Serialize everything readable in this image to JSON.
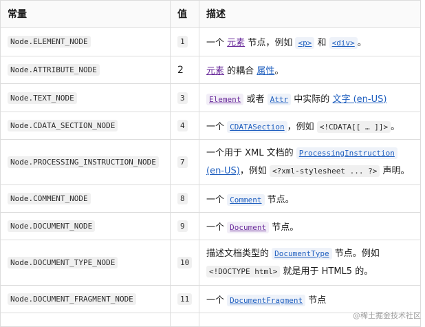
{
  "headers": [
    "常量",
    "值",
    "描述"
  ],
  "rows": [
    {
      "constant": "Node.ELEMENT_NODE",
      "value": "1",
      "desc": {
        "t1": "一个",
        "l1": "元素",
        "t2": "节点，例如",
        "c1": "<p>",
        "t3": "和",
        "c2": "<div>",
        "t4": "。"
      }
    },
    {
      "constant": "Node.ATTRIBUTE_NODE",
      "value": "2",
      "desc": {
        "l1": "元素",
        "t1": "的耦合",
        "l2": "属性",
        "t2": "。"
      }
    },
    {
      "constant": "Node.TEXT_NODE",
      "value": "3",
      "desc": {
        "l1": "Element",
        "t1": "或者",
        "l2": "Attr",
        "t2": "中实际的",
        "l3": "文字 (en-US)"
      }
    },
    {
      "constant": "Node.CDATA_SECTION_NODE",
      "value": "4",
      "desc": {
        "t1": "一个",
        "l1": "CDATASection",
        "t2": "，例如",
        "c1": "<!CDATA[[ … ]]>",
        "t3": "。"
      }
    },
    {
      "constant": "Node.PROCESSING_INSTRUCTION_NODE",
      "value": "7",
      "desc": {
        "t1": "一个用于 XML 文档的",
        "l1": "ProcessingInstruction",
        "l2": "(en-US)",
        "t2": "，例如",
        "c1": "<?xml-stylesheet ... ?>",
        "t3": "声明。"
      }
    },
    {
      "constant": "Node.COMMENT_NODE",
      "value": "8",
      "desc": {
        "t1": "一个",
        "l1": "Comment",
        "t2": "节点。"
      }
    },
    {
      "constant": "Node.DOCUMENT_NODE",
      "value": "9",
      "desc": {
        "t1": "一个",
        "l1": "Document",
        "t2": "节点。"
      }
    },
    {
      "constant": "Node.DOCUMENT_TYPE_NODE",
      "value": "10",
      "desc": {
        "t1": "描述文档类型的",
        "l1": "DocumentType",
        "t2": "节点。例如",
        "c1": "<!DOCTYPE html>",
        "t3": "就是用于 HTML5 的。"
      }
    },
    {
      "constant": "Node.DOCUMENT_FRAGMENT_NODE",
      "value": "11",
      "desc": {
        "t1": "一个",
        "l1": "DocumentFragment",
        "t2": "节点"
      }
    }
  ],
  "watermark": "@稀土掘金技术社区"
}
